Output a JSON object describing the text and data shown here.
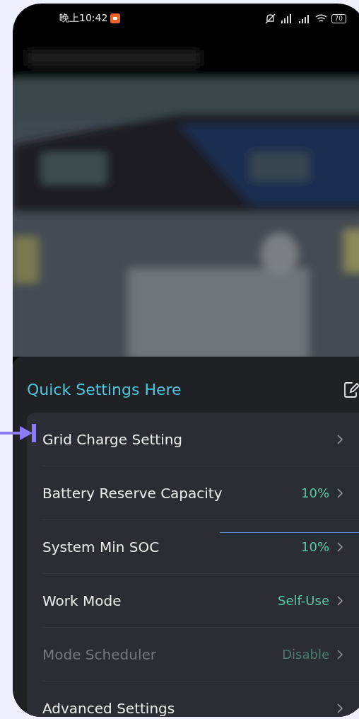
{
  "status_bar": {
    "time": "晚上10:42",
    "battery": "70"
  },
  "quick_settings": {
    "title": "Quick Settings Here",
    "items": [
      {
        "label": "Grid Charge Setting",
        "disabled": false
      },
      {
        "label": "Battery Reserve Capacity",
        "value": "10%",
        "disabled": false
      },
      {
        "label": "System Min SOC",
        "value": "10%",
        "disabled": false
      },
      {
        "label": "Work Mode",
        "value": "Self-Use",
        "disabled": false
      },
      {
        "label": "Mode Scheduler",
        "value": "Disable",
        "disabled": true
      },
      {
        "label": "Advanced Settings",
        "disabled": false
      }
    ]
  }
}
